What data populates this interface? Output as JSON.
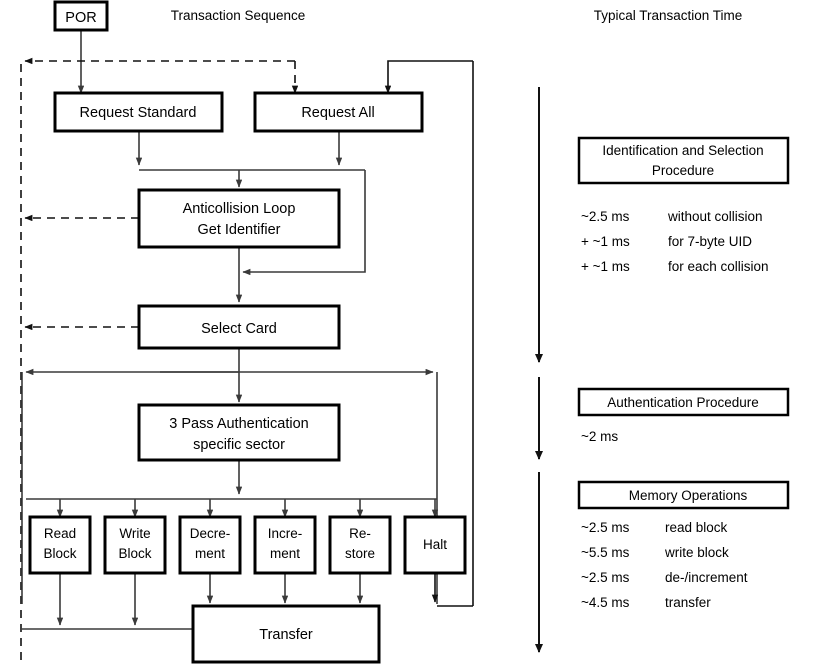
{
  "headers": {
    "left": "Transaction Sequence",
    "right": "Typical Transaction Time"
  },
  "flow_nodes": {
    "por": "POR",
    "request_standard": "Request Standard",
    "request_all": "Request All",
    "anticollision_l1": "Anticollision Loop",
    "anticollision_l2": "Get Identifier",
    "select_card": "Select Card",
    "auth_l1": "3 Pass Authentication",
    "auth_l2": "specific sector",
    "read_block_l1": "Read",
    "read_block_l2": "Block",
    "write_block_l1": "Write",
    "write_block_l2": "Block",
    "decrement_l1": "Decre-",
    "decrement_l2": "ment",
    "increment_l1": "Incre-",
    "increment_l2": "ment",
    "restore_l1": "Re-",
    "restore_l2": "store",
    "halt": "Halt",
    "transfer": "Transfer"
  },
  "timing": {
    "sections": [
      {
        "title_l1": "Identification and Selection",
        "title_l2": "Procedure",
        "rows": [
          {
            "time": "~2.5 ms",
            "desc": "without collision"
          },
          {
            "time": "+ ~1 ms",
            "desc": "for 7-byte UID"
          },
          {
            "time": "+ ~1 ms",
            "desc": "for each collision"
          }
        ]
      },
      {
        "title_l1": "Authentication Procedure",
        "title_l2": "",
        "rows": [
          {
            "time": "~2 ms",
            "desc": ""
          }
        ]
      },
      {
        "title_l1": "Memory Operations",
        "title_l2": "",
        "rows": [
          {
            "time": "~2.5 ms",
            "desc": "read block"
          },
          {
            "time": "~5.5 ms",
            "desc": "write block"
          },
          {
            "time": "~2.5 ms",
            "desc": "de-/increment"
          },
          {
            "time": "~4.5 ms",
            "desc": "transfer"
          }
        ]
      }
    ]
  },
  "colors": {
    "line": "#111111",
    "box_stroke": "#000000",
    "background": "#ffffff"
  }
}
